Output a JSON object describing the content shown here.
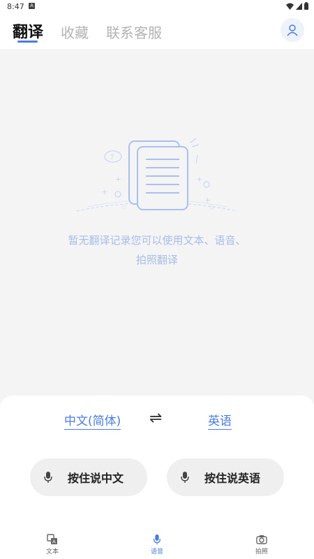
{
  "status": {
    "time": "8:47",
    "notif_glyph": "A"
  },
  "header": {
    "tabs": [
      {
        "label": "翻译",
        "active": true
      },
      {
        "label": "收藏",
        "active": false
      },
      {
        "label": "联系客服",
        "active": false
      }
    ],
    "profile_icon": "user-icon"
  },
  "empty_state": {
    "icon": "documents-illustration",
    "line1": "暂无翻译记录您可以使用文本、语音、",
    "line2": "拍照翻译"
  },
  "translate": {
    "source_lang": "中文(简体)",
    "swap_icon": "swap-icon",
    "target_lang": "英语",
    "hold_source": "按住说中文",
    "hold_target": "按住说英语"
  },
  "nav": {
    "items": [
      {
        "label": "文本",
        "icon": "text-translate-icon",
        "active": false
      },
      {
        "label": "语音",
        "icon": "microphone-icon",
        "active": true
      },
      {
        "label": "拍照",
        "icon": "camera-icon",
        "active": false
      }
    ]
  },
  "colors": {
    "accent": "#4a7de2",
    "muted_text": "#a8bde6",
    "background": "#f4f4f5"
  }
}
